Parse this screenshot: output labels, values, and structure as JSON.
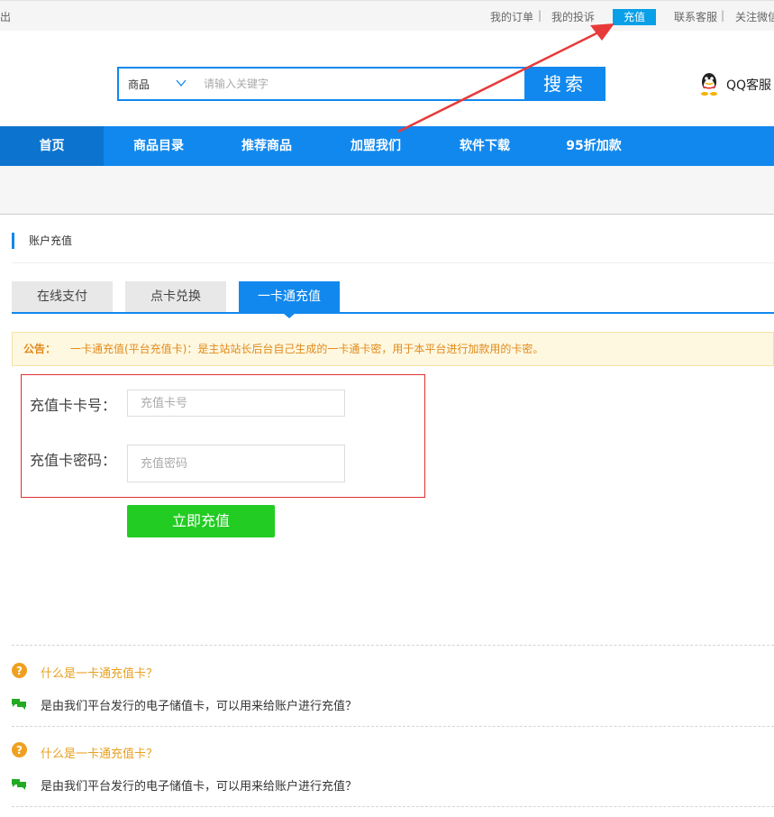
{
  "topbar": {
    "logout_fragment": "出",
    "links": [
      "我的订单",
      "我的投诉",
      "联系客服",
      "关注微信"
    ],
    "separators": [
      "|",
      "|"
    ],
    "recharge_label": "充值"
  },
  "search": {
    "category": "商品",
    "placeholder": "请输入关键字",
    "button_label": "搜索"
  },
  "qq_service": {
    "label": "QQ客服"
  },
  "nav": {
    "items": [
      {
        "label": "首页",
        "active": true
      },
      {
        "label": "商品目录"
      },
      {
        "label": "推荐商品"
      },
      {
        "label": "加盟我们"
      },
      {
        "label": "软件下载"
      },
      {
        "label": "95折加款"
      }
    ]
  },
  "section": {
    "title": "账户充值"
  },
  "tabs": [
    {
      "label": "在线支付"
    },
    {
      "label": "点卡兑换"
    },
    {
      "label": "一卡通充值",
      "active": true
    }
  ],
  "notice": {
    "label": "公告：",
    "text": "一卡通充值(平台充值卡)：是主站站长后台自己生成的一卡通卡密，用于本平台进行加款用的卡密。"
  },
  "form": {
    "card_number_label": "充值卡卡号：",
    "card_number_placeholder": "充值卡号",
    "card_password_label": "充值卡密码：",
    "card_password_placeholder": "充值密码",
    "submit_label": "立即充值"
  },
  "faq": [
    {
      "q": "什么是一卡通充值卡？",
      "a": "是由我们平台发行的电子储值卡，可以用来给账户进行充值？"
    },
    {
      "q": "什么是一卡通充值卡？",
      "a": "是由我们平台发行的电子储值卡，可以用来给账户进行充值？"
    }
  ],
  "colors": {
    "primary": "#1188ee",
    "recharge": "#0aa0e8",
    "submit": "#22cc22",
    "notice_text": "#e08a1c",
    "highlight_box": "#e03030",
    "annotation_arrow": "#e83a3a"
  },
  "icons": {
    "question": "question-icon",
    "answer": "chat-bubbles-icon",
    "qq": "qq-penguin-icon",
    "chevron": "chevron-down-icon"
  }
}
